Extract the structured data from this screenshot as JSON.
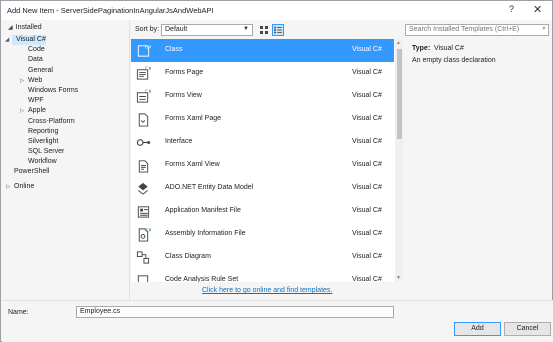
{
  "window": {
    "title": "Add New Item - ServerSidePaginationInAngularJsAndWebAPI",
    "help": "?",
    "close": "✕"
  },
  "left": {
    "installed": "Installed",
    "tree": [
      {
        "label": "Visual C#",
        "level": 0,
        "arrow": "◢",
        "selected": true
      },
      {
        "label": "Code",
        "level": 1
      },
      {
        "label": "Data",
        "level": 1
      },
      {
        "label": "General",
        "level": 1
      },
      {
        "label": "Web",
        "level": 1,
        "arrow": "▷"
      },
      {
        "label": "Windows Forms",
        "level": 1
      },
      {
        "label": "WPF",
        "level": 1
      },
      {
        "label": "Apple",
        "level": 1,
        "arrow": "▷"
      },
      {
        "label": "Cross-Platform",
        "level": 1
      },
      {
        "label": "Reporting",
        "level": 1
      },
      {
        "label": "Silverlight",
        "level": 1
      },
      {
        "label": "SQL Server",
        "level": 1
      },
      {
        "label": "Workflow",
        "level": 1
      },
      {
        "label": "PowerShell",
        "level": 0
      }
    ],
    "online": "Online"
  },
  "toolbar": {
    "sort_label": "Sort by:",
    "sort_value": "Default"
  },
  "templates": [
    {
      "name": "Class",
      "lang": "Visual C#",
      "icon": "class-icon",
      "selected": true
    },
    {
      "name": "Forms Page",
      "lang": "Visual C#",
      "icon": "forms-page-icon"
    },
    {
      "name": "Forms View",
      "lang": "Visual C#",
      "icon": "forms-view-icon"
    },
    {
      "name": "Forms Xaml Page",
      "lang": "Visual C#",
      "icon": "xaml-page-icon"
    },
    {
      "name": "Interface",
      "lang": "Visual C#",
      "icon": "interface-icon"
    },
    {
      "name": "Forms Xaml View",
      "lang": "Visual C#",
      "icon": "xaml-view-icon"
    },
    {
      "name": "ADO.NET Entity Data Model",
      "lang": "Visual C#",
      "icon": "entity-model-icon"
    },
    {
      "name": "Application Manifest File",
      "lang": "Visual C#",
      "icon": "manifest-icon"
    },
    {
      "name": "Assembly Information File",
      "lang": "Visual C#",
      "icon": "assembly-info-icon"
    },
    {
      "name": "Class Diagram",
      "lang": "Visual C#",
      "icon": "class-diagram-icon"
    },
    {
      "name": "Code Analysis Rule Set",
      "lang": "Visual C#",
      "icon": "ruleset-icon"
    }
  ],
  "online_link": "Click here to go online and find templates.",
  "details": {
    "search_placeholder": "Search Installed Templates (Ctrl+E)",
    "type_label": "Type:",
    "type_value": "Visual C#",
    "description": "An empty class declaration"
  },
  "footer": {
    "name_label": "Name:",
    "name_value": "Employee.cs",
    "add": "Add",
    "cancel": "Cancel"
  },
  "colors": {
    "accent": "#3399ff",
    "link": "#0e70c0",
    "selection_light": "#cde8ff"
  }
}
